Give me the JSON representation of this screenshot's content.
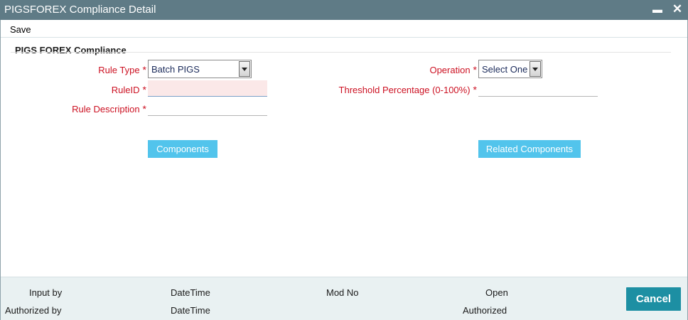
{
  "window": {
    "title": "PIGSFOREX Compliance Detail",
    "minimize_icon": "minimize-icon",
    "close_icon": "close-icon"
  },
  "toolbar": {
    "save_label": "Save"
  },
  "section": {
    "title": "PIGS FOREX Compliance"
  },
  "form": {
    "rule_type": {
      "label": "Rule Type",
      "value": "Batch PIGS"
    },
    "rule_id": {
      "label": "RuleID",
      "value": ""
    },
    "rule_description": {
      "label": "Rule Description",
      "value": ""
    },
    "operation": {
      "label": "Operation",
      "value": "Select One"
    },
    "threshold": {
      "label": "Threshold Percentage (0-100%)",
      "value": ""
    },
    "required_mark": "*"
  },
  "buttons": {
    "components": "Components",
    "related_components": "Related Components"
  },
  "footer": {
    "input_by": "Input by",
    "authorized_by": "Authorized by",
    "datetime_1": "DateTime",
    "datetime_2": "DateTime",
    "mod_no": "Mod No",
    "open": "Open",
    "authorized": "Authorized",
    "cancel_label": "Cancel"
  },
  "colors": {
    "titlebar": "#5f7b86",
    "label_red": "#cc1122",
    "button_blue": "#52c4ec",
    "cancel_teal": "#1d8fa3",
    "footer_bg": "#e9f1f2"
  }
}
